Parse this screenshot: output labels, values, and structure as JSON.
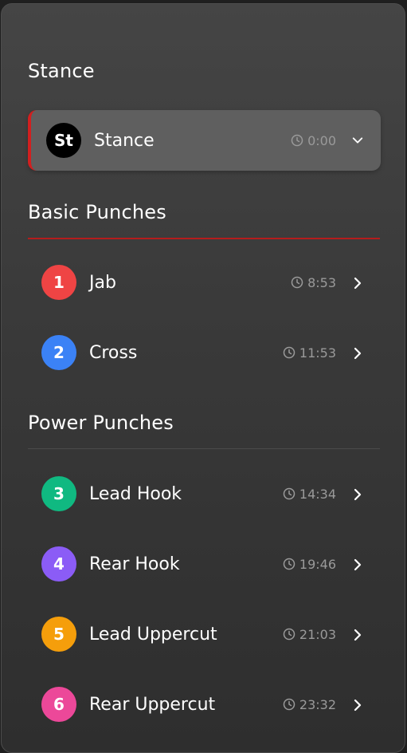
{
  "colors": {
    "accent": "#d21f1f",
    "badge_stance": "#000000",
    "badge_1": "#ef4444",
    "badge_2": "#3b82f6",
    "badge_3": "#10b981",
    "badge_4": "#8b5cf6",
    "badge_5": "#f59e0b",
    "badge_6": "#ec4899"
  },
  "sections": [
    {
      "title": "Stance",
      "items": [
        {
          "badge": "St",
          "label": "Stance",
          "time": "0:00",
          "icon": "chevron-down-icon",
          "active": true
        }
      ]
    },
    {
      "title": "Basic Punches",
      "items": [
        {
          "badge": "1",
          "label": "Jab",
          "time": "8:53",
          "icon": "chevron-right-icon"
        },
        {
          "badge": "2",
          "label": "Cross",
          "time": "11:53",
          "icon": "chevron-right-icon"
        }
      ]
    },
    {
      "title": "Power Punches",
      "items": [
        {
          "badge": "3",
          "label": "Lead Hook",
          "time": "14:34",
          "icon": "chevron-right-icon"
        },
        {
          "badge": "4",
          "label": "Rear Hook",
          "time": "19:46",
          "icon": "chevron-right-icon"
        },
        {
          "badge": "5",
          "label": "Lead Uppercut",
          "time": "21:03",
          "icon": "chevron-right-icon"
        },
        {
          "badge": "6",
          "label": "Rear Uppercut",
          "time": "23:32",
          "icon": "chevron-right-icon"
        }
      ]
    }
  ]
}
